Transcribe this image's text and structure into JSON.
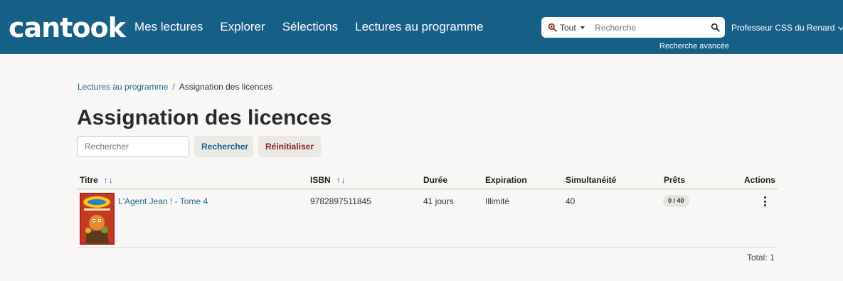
{
  "header": {
    "logo": "cantook",
    "nav": [
      "Mes lectures",
      "Explorer",
      "Sélections",
      "Lectures au programme"
    ],
    "search": {
      "scope": "Tout",
      "placeholder": "Recherche",
      "advanced": "Recherche avancée"
    },
    "user": "Professeur CSS du Renard",
    "colors": {
      "bar": "#165f87"
    }
  },
  "breadcrumb": {
    "parent": "Lectures au programme",
    "separator": "/",
    "current": "Assignation des licences"
  },
  "page_title": "Assignation des licences",
  "filters": {
    "input_placeholder": "Rechercher",
    "search_label": "Rechercher",
    "reset_label": "Réinitialiser"
  },
  "table": {
    "columns": {
      "title": "Titre",
      "isbn": "ISBN",
      "duration": "Durée",
      "expiration": "Expiration",
      "concurrency": "Simultanéité",
      "loans": "Prêts",
      "actions": "Actions"
    },
    "sort_glyphs": "↑↓",
    "rows": [
      {
        "title": "L'Agent Jean ! - Tome 4",
        "isbn": "9782897511845",
        "duration": "41 jours",
        "expiration": "Illimité",
        "concurrency": "40",
        "loans": "0 / 40"
      }
    ],
    "total": "Total: 1"
  }
}
